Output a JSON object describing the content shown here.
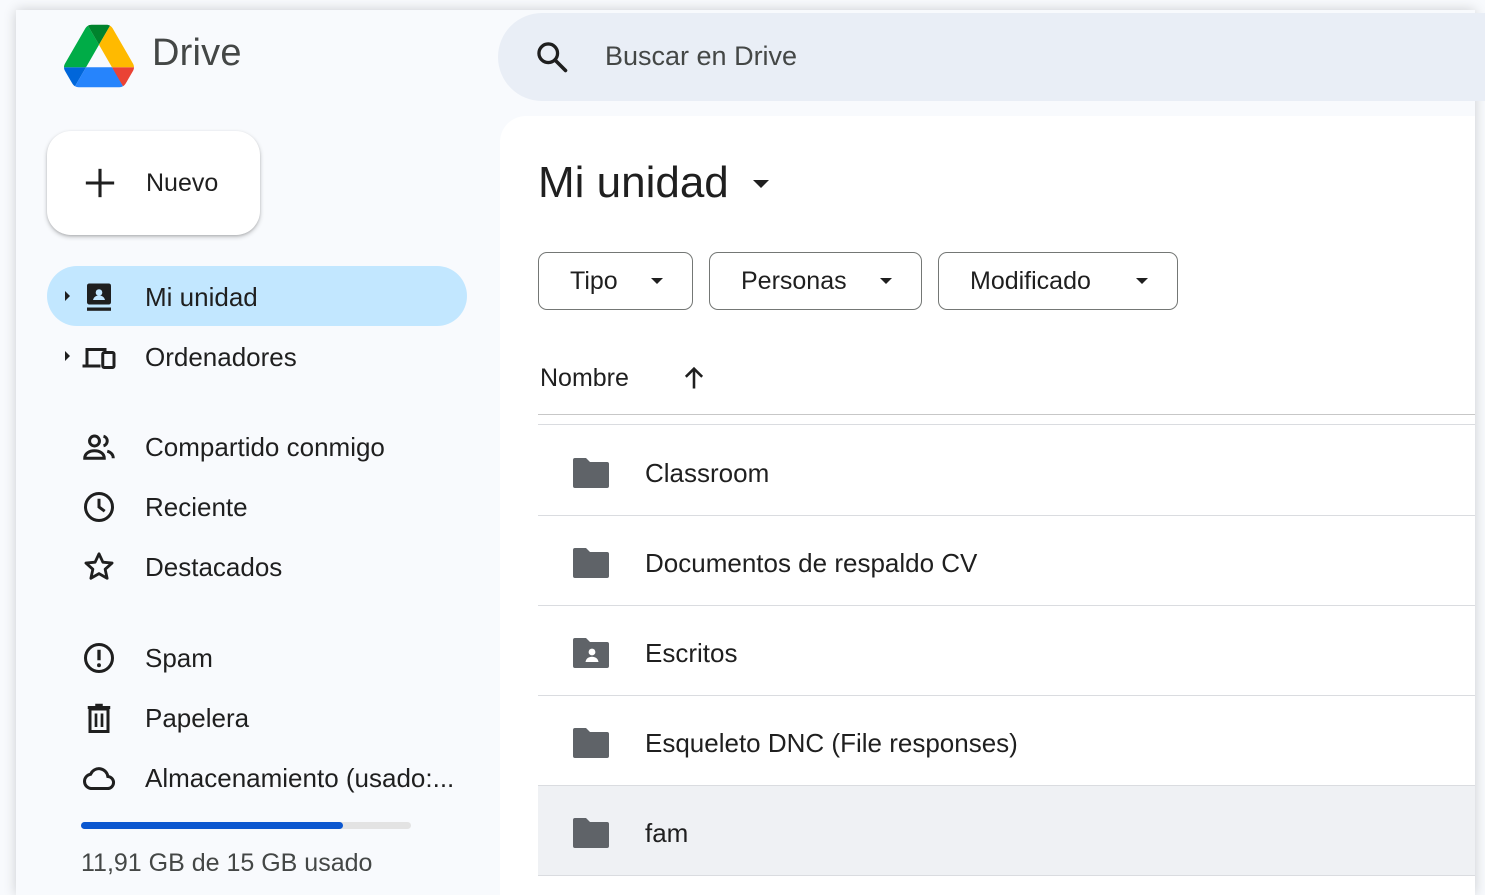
{
  "app": {
    "brand": "Drive"
  },
  "search": {
    "placeholder": "Buscar en Drive"
  },
  "new_button": {
    "label": "Nuevo"
  },
  "sidebar": {
    "items": [
      {
        "label": "Mi unidad",
        "icon": "drive-icon",
        "active": true
      },
      {
        "label": "Ordenadores",
        "icon": "computers-icon",
        "active": false
      },
      {
        "label": "Compartido conmigo",
        "icon": "people-icon",
        "active": false
      },
      {
        "label": "Reciente",
        "icon": "clock-icon",
        "active": false
      },
      {
        "label": "Destacados",
        "icon": "star-icon",
        "active": false
      },
      {
        "label": "Spam",
        "icon": "spam-icon",
        "active": false
      },
      {
        "label": "Papelera",
        "icon": "trash-icon",
        "active": false
      },
      {
        "label": "Almacenamiento (usado:...",
        "icon": "cloud-icon",
        "active": false
      }
    ],
    "storage": {
      "text": "11,91 GB de 15 GB usado",
      "used_fraction": 0.794
    }
  },
  "main": {
    "title": "Mi unidad",
    "filters": [
      {
        "label": "Tipo"
      },
      {
        "label": "Personas"
      },
      {
        "label": "Modificado"
      }
    ],
    "column": {
      "name": "Nombre"
    },
    "files": [
      {
        "name": "Classroom",
        "icon": "folder-icon"
      },
      {
        "name": "Documentos de respaldo CV",
        "icon": "folder-icon"
      },
      {
        "name": "Escritos",
        "icon": "shared-folder-icon"
      },
      {
        "name": "Esqueleto DNC (File responses)",
        "icon": "folder-icon"
      },
      {
        "name": "fam",
        "icon": "folder-icon"
      }
    ]
  },
  "colors": {
    "active_nav": "#c2e7ff",
    "search_bg": "#e9eef6",
    "storage_fill": "#0b57d0",
    "folder": "#5f6368"
  }
}
